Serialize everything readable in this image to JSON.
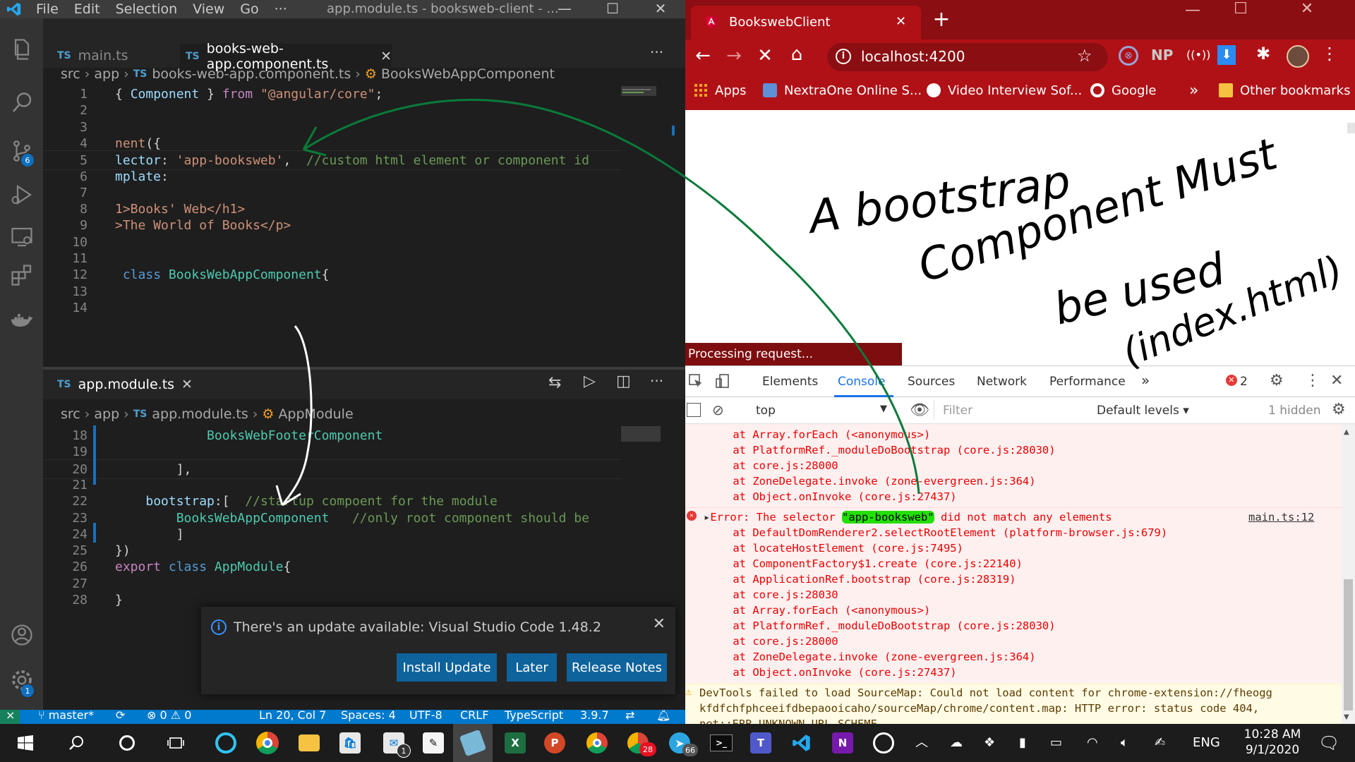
{
  "vscode": {
    "menu": [
      "File",
      "Edit",
      "Selection",
      "View",
      "Go",
      "···"
    ],
    "window_title": "app.module.ts - booksweb-client - ...",
    "top_tabs": [
      {
        "label": "main.ts",
        "active": false
      },
      {
        "label": "books-web-app.component.ts",
        "active": true
      }
    ],
    "more": "···",
    "breadcrumb_top": {
      "p1": "src",
      "p2": "app",
      "file": "books-web-app.component.ts",
      "symbol": "BooksWebAppComponent"
    },
    "scm_badge": "6",
    "settings_badge": "1",
    "top_lines": [
      {
        "n": "1",
        "t": [
          [
            "pun",
            "{ "
          ],
          [
            "var",
            "Component"
          ],
          [
            "pun",
            " } "
          ],
          [
            "kw2",
            "from"
          ],
          [
            "pun",
            " "
          ],
          [
            "str",
            "\"@angular/core\""
          ],
          [
            "pun",
            ";"
          ]
        ]
      },
      {
        "n": "2",
        "t": []
      },
      {
        "n": "3",
        "t": []
      },
      {
        "n": "4",
        "t": [
          [
            "str",
            "nent"
          ],
          [
            "pun",
            "({"
          ]
        ]
      },
      {
        "n": "5",
        "t": [
          [
            "var",
            "lector"
          ],
          [
            "pun",
            ": "
          ],
          [
            "str",
            "'app-booksweb'"
          ],
          [
            "pun",
            ",  "
          ],
          [
            "cmt",
            "//custom html element or component id"
          ]
        ]
      },
      {
        "n": "6",
        "t": [
          [
            "var",
            "mplate"
          ],
          [
            "pun",
            ":"
          ]
        ]
      },
      {
        "n": "7",
        "t": []
      },
      {
        "n": "8",
        "t": [
          [
            "str",
            "1>Books' Web</h1>"
          ]
        ]
      },
      {
        "n": "9",
        "t": [
          [
            "str",
            ">The World of Books</p>"
          ]
        ]
      },
      {
        "n": "10",
        "t": []
      },
      {
        "n": "11",
        "t": []
      },
      {
        "n": "12",
        "t": [
          [
            "pun",
            " "
          ],
          [
            "kw",
            "class"
          ],
          [
            "pun",
            " "
          ],
          [
            "cls",
            "BooksWebAppComponent"
          ],
          [
            "pun",
            "{"
          ]
        ]
      },
      {
        "n": "13",
        "t": []
      },
      {
        "n": "14",
        "t": []
      }
    ],
    "bottom_tab": "app.module.ts",
    "breadcrumb_bottom": {
      "p1": "src",
      "p2": "app",
      "file": "app.module.ts",
      "symbol": "AppModule"
    },
    "bottom_lines": [
      {
        "n": "18",
        "t": [
          [
            "pun",
            "            "
          ],
          [
            "cls",
            "BooksWebFooterComponent"
          ]
        ]
      },
      {
        "n": "19",
        "t": []
      },
      {
        "n": "20",
        "t": [
          [
            "pun",
            "        ],"
          ]
        ]
      },
      {
        "n": "21",
        "t": []
      },
      {
        "n": "22",
        "t": [
          [
            "pun",
            "    "
          ],
          [
            "var",
            "bootstrap"
          ],
          [
            "pun",
            ":[  "
          ],
          [
            "cmt",
            "//startup compoent for the module"
          ]
        ]
      },
      {
        "n": "23",
        "t": [
          [
            "pun",
            "        "
          ],
          [
            "cls",
            "BooksWebAppComponent"
          ],
          [
            "pun",
            "   "
          ],
          [
            "cmt",
            "//only root component should be"
          ]
        ]
      },
      {
        "n": "24",
        "t": [
          [
            "pun",
            "        ]"
          ]
        ]
      },
      {
        "n": "25",
        "t": [
          [
            "pun",
            "})"
          ]
        ]
      },
      {
        "n": "26",
        "t": [
          [
            "kw2",
            "export"
          ],
          [
            "pun",
            " "
          ],
          [
            "kw",
            "class"
          ],
          [
            "pun",
            " "
          ],
          [
            "cls",
            "AppModule"
          ],
          [
            "pun",
            "{"
          ]
        ]
      },
      {
        "n": "27",
        "t": []
      },
      {
        "n": "28",
        "t": [
          [
            "pun",
            "}"
          ]
        ]
      }
    ],
    "notification": {
      "message": "There's an update available: Visual Studio Code 1.48.2",
      "install": "Install Update",
      "later": "Later",
      "notes": "Release Notes"
    },
    "status": {
      "branch": "master*",
      "problems": "⊗ 0 ⚠ 0",
      "position": "Ln 20, Col 7",
      "spaces": "Spaces: 4",
      "encoding": "UTF-8",
      "eol": "CRLF",
      "language": "TypeScript",
      "version": "3.9.7"
    }
  },
  "chrome": {
    "tab_title": "BookswebClient",
    "url": "localhost:4200",
    "np": "NP",
    "bookmarks": [
      {
        "label": "Apps"
      },
      {
        "label": "NextraOne Online S..."
      },
      {
        "label": "Video Interview Sof..."
      },
      {
        "label": "Google"
      }
    ],
    "bm_more": "»",
    "other_bookmarks": "Other bookmarks",
    "processing": "Processing request...",
    "annotation_lines": [
      "A bootstrap",
      "Component Must",
      "be used",
      "(index.html)"
    ],
    "devtools": {
      "tabs": [
        "Elements",
        "Console",
        "Sources",
        "Network",
        "Performance"
      ],
      "more_tabs": "»",
      "error_count": "2",
      "context": "top",
      "filter_placeholder": "Filter",
      "levels": "Default levels ▾",
      "hidden": "1 hidden"
    },
    "console_prev": [
      "    at Array.forEach (<anonymous>)",
      "    at PlatformRef._moduleDoBootstrap (core.js:28030)",
      "    at core.js:28000",
      "    at ZoneDelegate.invoke (zone-evergreen.js:364)",
      "    at Object.onInvoke (core.js:27437)"
    ],
    "error_head_pre": "Error: The selector ",
    "error_selector": "\"app-booksweb\"",
    "error_head_post": " did not match any elements",
    "error_source": "main.ts:12",
    "console_stack": [
      "    at DefaultDomRenderer2.selectRootElement (platform-browser.js:679)",
      "    at locateHostElement (core.js:7495)",
      "    at ComponentFactory$1.create (core.js:22140)",
      "    at ApplicationRef.bootstrap (core.js:28319)",
      "    at core.js:28030",
      "    at Array.forEach (<anonymous>)",
      "    at PlatformRef._moduleDoBootstrap (core.js:28030)",
      "    at core.js:28000",
      "    at ZoneDelegate.invoke (zone-evergreen.js:364)",
      "    at Object.onInvoke (core.js:27437)"
    ],
    "warning_lines": [
      "DevTools failed to load SourceMap: Could not load content for chrome-extension://fheogg",
      "kfdfchfphceeifdbepaooicaho/sourceMap/chrome/content.map: HTTP error: status code 404,",
      "net::ERR_UNKNOWN_URL_SCHEME"
    ]
  },
  "taskbar": {
    "outlook_badge": "1",
    "chrome_badge": "28",
    "telegram_badge": "66",
    "lang": "ENG",
    "time": "10:28 AM",
    "date": "9/1/2020"
  },
  "colors": {
    "vscode_bg": "#1e1e1e",
    "vscode_status": "#007acc",
    "chrome_theme": "#b01117",
    "annotation_green": "#0a7a3a",
    "highlight_green": "#22e000"
  }
}
